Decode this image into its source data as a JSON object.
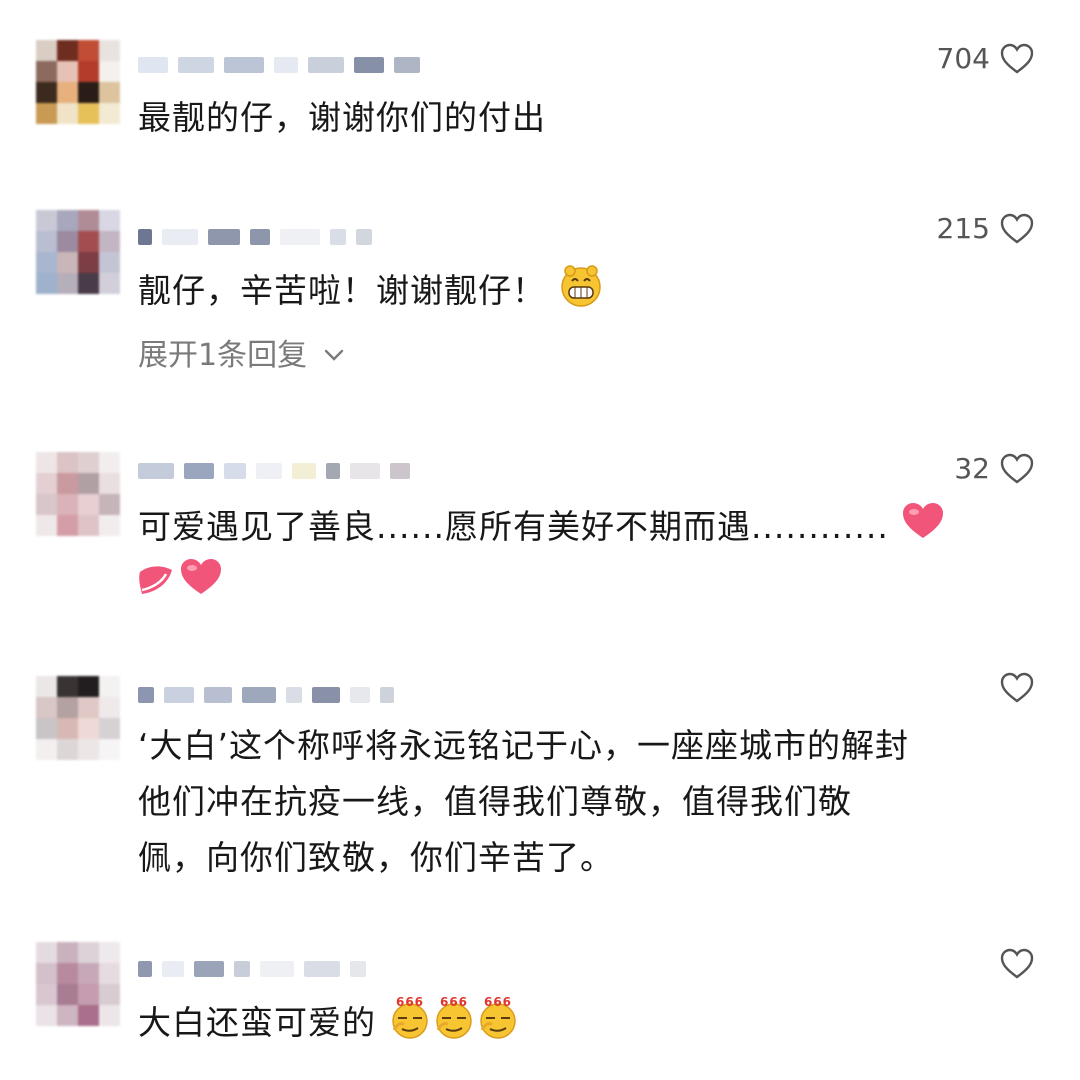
{
  "comments": [
    {
      "text": "最靓的仔，谢谢你们的付出",
      "likes": "704"
    },
    {
      "text": "靓仔，辛苦啦！谢谢靓仔！",
      "likes": "215",
      "expand": "展开1条回复",
      "emoji": "grin-emoji"
    },
    {
      "text": "可爱遇见了善良......愿所有美好不期而遇............",
      "likes": "32",
      "emoji": "heart-emoji"
    },
    {
      "lines": [
        "‘大白’这个称呼将永远铭记于心，一座座城市的解封",
        "他们冲在抗疫一线，值得我们尊敬，值得我们敬",
        "佩，向你们致敬，你们辛苦了。"
      ],
      "likes": ""
    },
    {
      "text": "大白还蛮可爱的",
      "likes": "",
      "emoji": "666-emoji",
      "emoji_label": "666"
    }
  ],
  "colors": {
    "heart": "#f2557a",
    "emoji_yellow": "#f7c531"
  }
}
